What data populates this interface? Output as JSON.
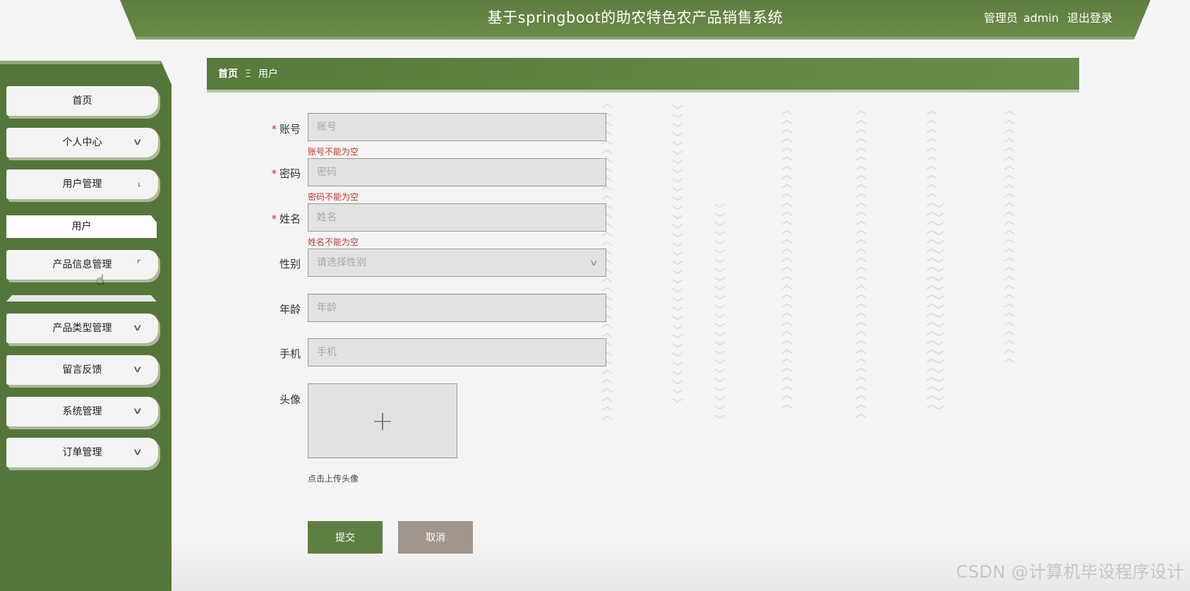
{
  "header": {
    "title": "基于springboot的助农特色农产品销售系统",
    "user_role": "管理员",
    "username": "admin",
    "logout_label": "退出登录"
  },
  "sidebar": {
    "items": [
      {
        "label": "首页",
        "icon": "none"
      },
      {
        "label": "个人中心",
        "icon": "chevron-down-icon"
      },
      {
        "label": "用户管理",
        "icon": "corner-icon"
      },
      {
        "label": "用户",
        "icon": "none"
      },
      {
        "label": "产品信息管理",
        "icon": "corner-icon"
      },
      {
        "label": "产品类型管理",
        "icon": "chevron-down-icon"
      },
      {
        "label": "留言反馈",
        "icon": "chevron-down-icon"
      },
      {
        "label": "系统管理",
        "icon": "chevron-down-icon"
      },
      {
        "label": "订单管理",
        "icon": "chevron-down-icon"
      }
    ]
  },
  "breadcrumb": {
    "home": "首页",
    "separator": "Ξ",
    "current": "用户"
  },
  "form": {
    "account": {
      "label": "账号",
      "placeholder": "账号",
      "error": "账号不能为空",
      "required": true
    },
    "password": {
      "label": "密码",
      "placeholder": "密码",
      "error": "密码不能为空",
      "required": true
    },
    "name": {
      "label": "姓名",
      "placeholder": "姓名",
      "error": "姓名不能为空",
      "required": true
    },
    "gender": {
      "label": "性别",
      "placeholder": "请选择性别"
    },
    "age": {
      "label": "年龄",
      "placeholder": "年龄"
    },
    "phone": {
      "label": "手机",
      "placeholder": "手机"
    },
    "avatar": {
      "label": "头像",
      "tip": "点击上传头像"
    },
    "required_mark": "*",
    "submit_label": "提交",
    "cancel_label": "取消"
  },
  "watermark": "CSDN @计算机毕设程序设计",
  "colors": {
    "primary_green": "#5e7f41",
    "cancel_gray": "#a0958c",
    "error_red": "#c0392b"
  }
}
